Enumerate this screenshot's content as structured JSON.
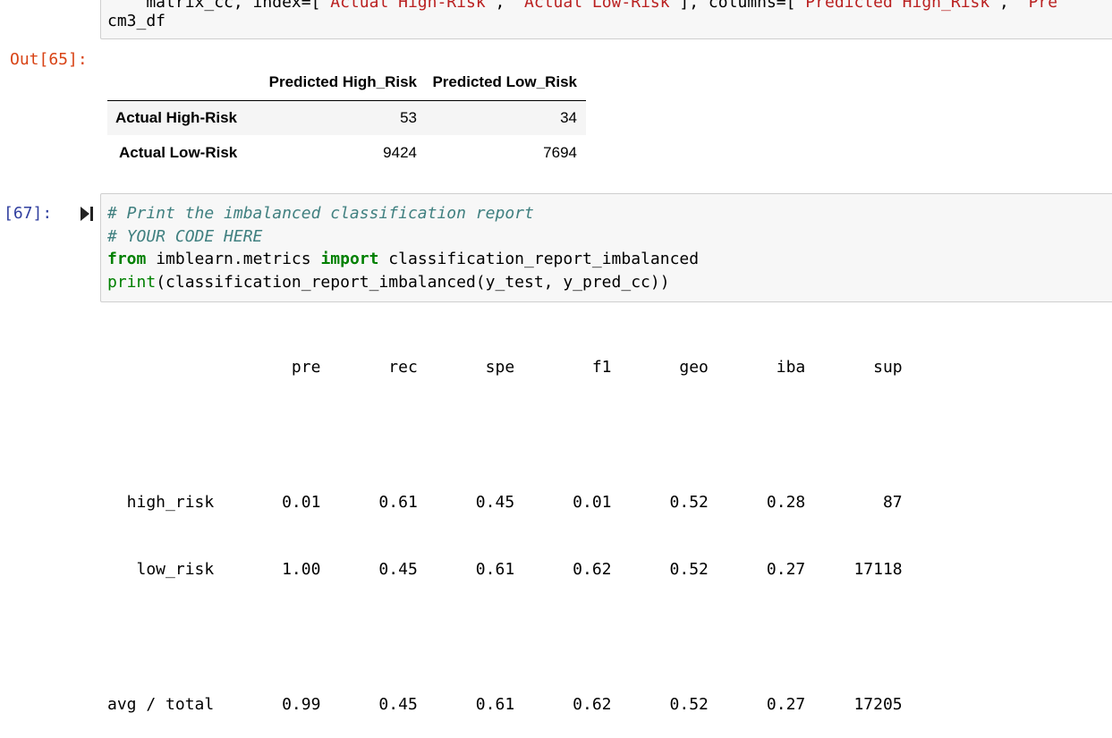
{
  "cell_top": {
    "code_line_1_segments": [
      {
        "text": "    matrix_cc, index=",
        "cls": ""
      },
      {
        "text": "[",
        "cls": ""
      },
      {
        "text": "\"Actual High-Risk\"",
        "cls": "cm-string"
      },
      {
        "text": ", ",
        "cls": ""
      },
      {
        "text": "\"Actual Low-Risk\"",
        "cls": "cm-string"
      },
      {
        "text": "], columns=[",
        "cls": ""
      },
      {
        "text": "\"Predicted High_Risk\"",
        "cls": "cm-string"
      },
      {
        "text": ", ",
        "cls": ""
      },
      {
        "text": "\"Pre",
        "cls": "cm-string"
      }
    ],
    "code_line_2": "cm3_df"
  },
  "out_prompt": "Out[65]:",
  "dataframe": {
    "columns": [
      "",
      "Predicted High_Risk",
      "Predicted Low_Risk"
    ],
    "rows": [
      {
        "index": "Actual High-Risk",
        "values": [
          "53",
          "34"
        ]
      },
      {
        "index": "Actual Low-Risk",
        "values": [
          "9424",
          "7694"
        ]
      }
    ]
  },
  "cell_67": {
    "prompt": "[67]:",
    "run_icon": "run-cell-icon",
    "lines": {
      "l1": "# Print the imbalanced classification report",
      "l2": "# YOUR CODE HERE",
      "l3_kw1": "from",
      "l3_mod": " imblearn.metrics ",
      "l3_kw2": "import",
      "l3_name": " classification_report_imbalanced",
      "l4_builtin": "print",
      "l4_rest": "(classification_report_imbalanced(y_test, y_pred_cc))"
    }
  },
  "report": {
    "header": "                   pre       rec       spe        f1       geo       iba       sup",
    "row_high": "  high_risk       0.01      0.61      0.45      0.01      0.52      0.28        87",
    "row_low": "   low_risk       1.00      0.45      0.61      0.62      0.52      0.27     17118",
    "row_avg": "avg / total       0.99      0.45      0.61      0.62      0.52      0.27     17205"
  }
}
